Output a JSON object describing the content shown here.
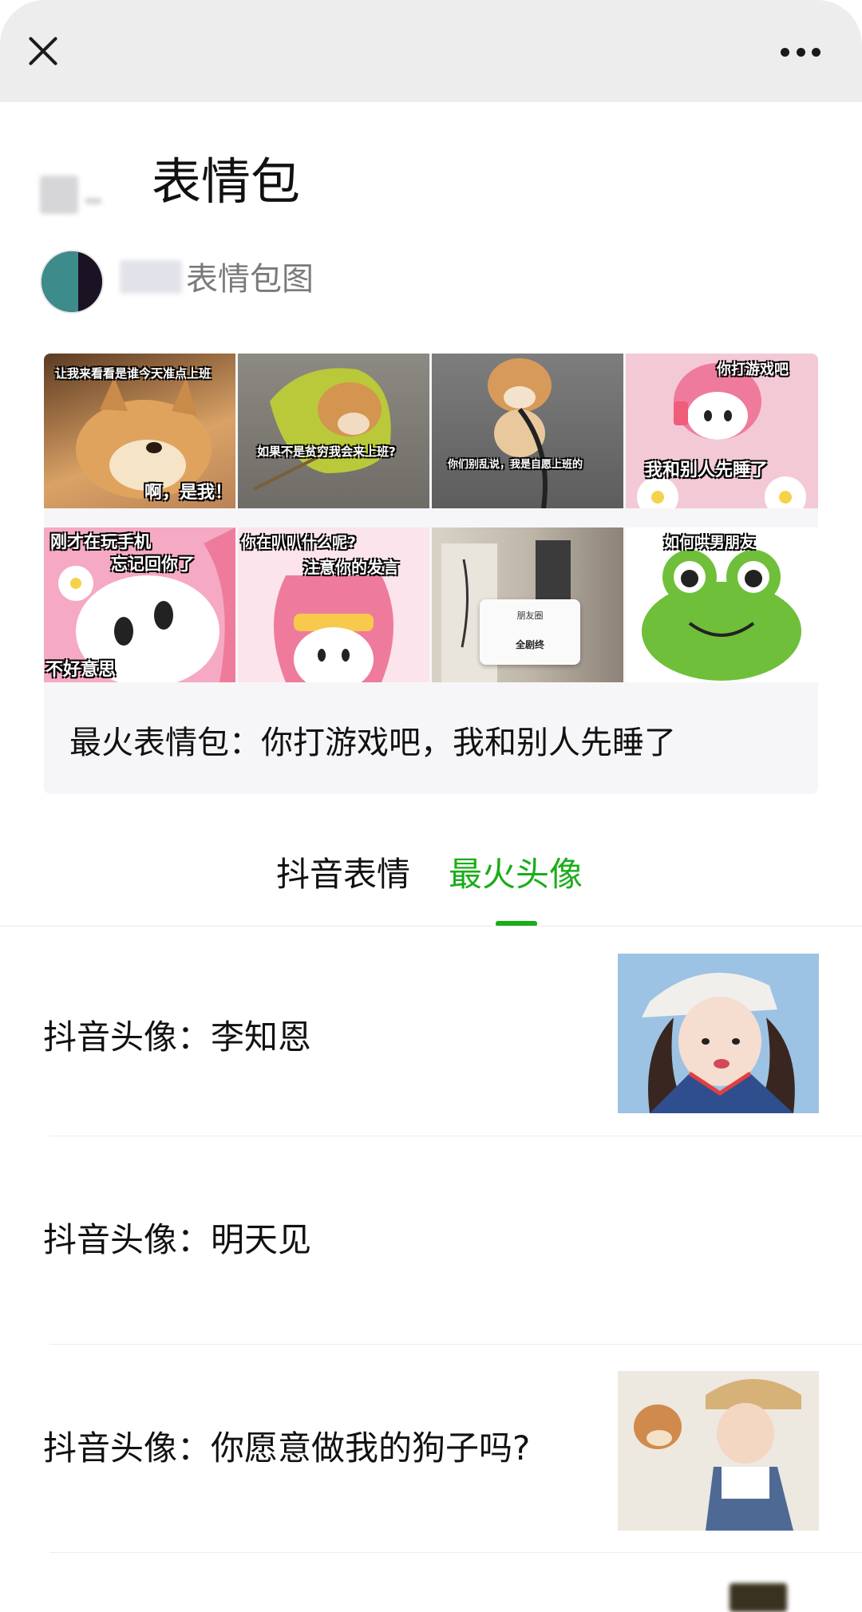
{
  "article": {
    "title": "表情包",
    "author_suffix": "表情包图"
  },
  "cover": {
    "captions": [
      "让我来看看是谁今天准点上班",
      "啊，是我！",
      "如果不是贫穷我会来上班?",
      "你们别乱说，我是自愿上班的",
      "你打游戏吧",
      "我和别人先睡了",
      "刚才在玩手机",
      "忘记回你了",
      "不好意思",
      "你在叭叭什么呢?",
      "注意你的发言",
      "朋友圈",
      "全剧终",
      "如何哄男朋友"
    ],
    "title": "最火表情包：你打游戏吧，我和别人先睡了"
  },
  "tabs": [
    {
      "label": "抖音表情",
      "active": false
    },
    {
      "label": "最火头像",
      "active": true
    }
  ],
  "colors": {
    "accent": "#1aad19",
    "topbar": "#ededed",
    "card_bg": "#f6f6f8"
  },
  "icons": {
    "close": "close-icon",
    "more": "more-icon"
  },
  "list": [
    {
      "title": "抖音头像：李知恩",
      "has_thumb": true
    },
    {
      "title": "抖音头像：明天见",
      "has_thumb": false
    },
    {
      "title": "抖音头像：你愿意做我的狗子吗?",
      "has_thumb": true
    }
  ]
}
